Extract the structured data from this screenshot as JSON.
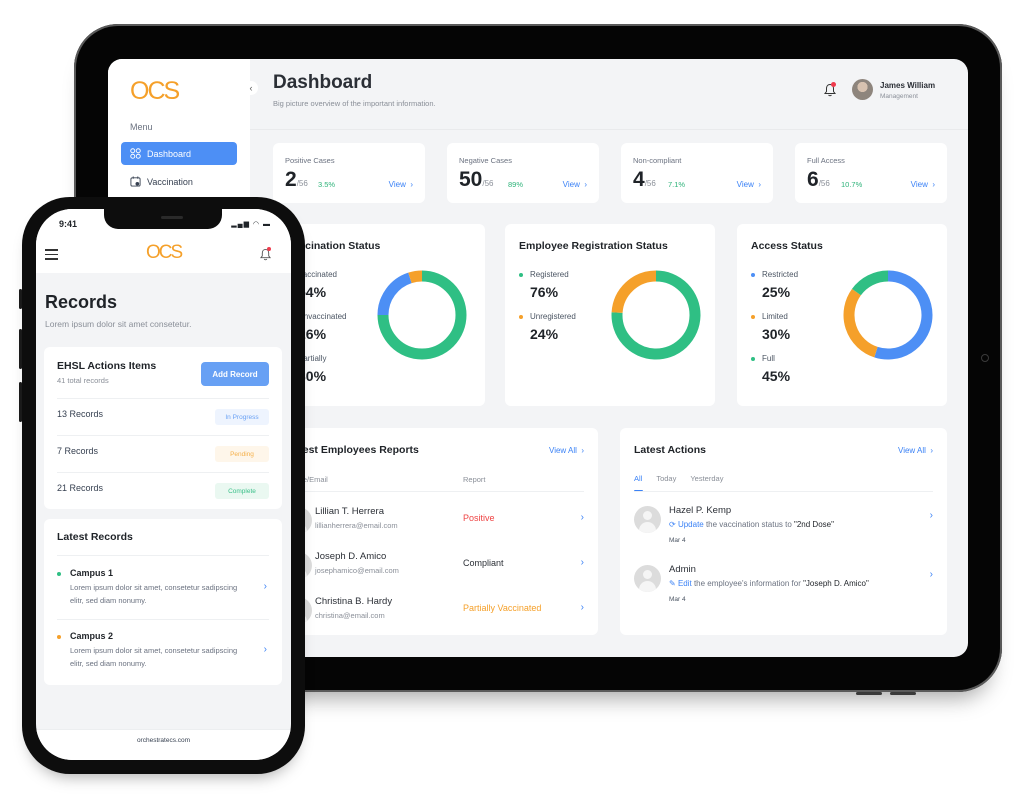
{
  "tablet": {
    "brand": "OCS",
    "sidebar": {
      "menu_label": "Menu",
      "items": [
        {
          "label": "Dashboard",
          "icon": "grid-icon",
          "active": true
        },
        {
          "label": "Vaccination",
          "icon": "calendar-icon",
          "active": false
        }
      ]
    },
    "header": {
      "title": "Dashboard",
      "subtitle": "Big picture overview of the important information.",
      "user_name": "James William",
      "user_role": "Management"
    },
    "stats": [
      {
        "label": "Positive Cases",
        "value": "2",
        "total": "/56",
        "percent": "3.5%",
        "link": "View"
      },
      {
        "label": "Negative Cases",
        "value": "50",
        "total": "/56",
        "percent": "89%",
        "link": "View"
      },
      {
        "label": "Non-compliant",
        "value": "4",
        "total": "/56",
        "percent": "7.1%",
        "link": "View"
      },
      {
        "label": "Full Access",
        "value": "6",
        "total": "/56",
        "percent": "10.7%",
        "link": "View"
      }
    ],
    "vaccination": {
      "title": "Vaccination Status",
      "items": [
        {
          "label": "Vaccinated",
          "value": "54%"
        },
        {
          "label": "Unvaccinated",
          "value": "26%"
        },
        {
          "label": "Partially",
          "value": "30%"
        }
      ]
    },
    "registration": {
      "title": "Employee Registration Status",
      "items": [
        {
          "label": "Registered",
          "value": "76%"
        },
        {
          "label": "Unregistered",
          "value": "24%"
        }
      ]
    },
    "access": {
      "title": "Access Status",
      "items": [
        {
          "label": "Restricted",
          "value": "25%"
        },
        {
          "label": "Limited",
          "value": "30%"
        },
        {
          "label": "Full",
          "value": "45%"
        }
      ]
    },
    "reports": {
      "title": "Latest Employees Reports",
      "view_all": "View All",
      "col_name": "Name/Email",
      "col_report": "Report",
      "rows": [
        {
          "name": "Lillian T. Herrera",
          "email": "lillianherrera@email.com",
          "report": "Positive",
          "color": "#ef4444"
        },
        {
          "name": "Joseph D. Amico",
          "email": "josephamico@email.com",
          "report": "Compliant",
          "color": "#2b2f36"
        },
        {
          "name": "Christina B. Hardy",
          "email": "christina@email.com",
          "report": "Partially Vaccinated",
          "color": "#f5a02a"
        }
      ]
    },
    "actions": {
      "title": "Latest Actions",
      "view_all": "View All",
      "tabs": [
        "All",
        "Today",
        "Yesterday"
      ],
      "active_tab": "All",
      "rows": [
        {
          "name": "Hazel P. Kemp",
          "verb": "Update",
          "text": " the vaccination status to ",
          "target": "\"2nd Dose\"",
          "date": "Mar 4",
          "icon": "refresh-icon"
        },
        {
          "name": "Admin",
          "verb": "Edit",
          "text": " the employee's information for ",
          "target": "\"Joseph D. Amico\"",
          "date": "Mar 4",
          "icon": "pencil-icon"
        }
      ]
    }
  },
  "phone": {
    "time": "9:41",
    "brand": "OCS",
    "title": "Records",
    "subtitle": "Lorem ipsum dolor sit amet consetetur.",
    "ehsl": {
      "title": "EHSL Actions Items",
      "subtitle": "41 total records",
      "add_button": "Add Record",
      "rows": [
        {
          "label": "13 Records",
          "status": "In Progress"
        },
        {
          "label": "7 Records",
          "status": "Pending"
        },
        {
          "label": "21 Records",
          "status": "Complete"
        }
      ]
    },
    "latest": {
      "title": "Latest Records",
      "items": [
        {
          "name": "Campus 1",
          "desc": "Lorem ipsum dolor sit amet, consetetur sadipscing elitr, sed diam nonumy."
        },
        {
          "name": "Campus 2",
          "desc": "Lorem ipsum dolor sit amet, consetetur sadipscing elitr, sed diam nonumy."
        }
      ]
    },
    "footer": "orchestratecs.com"
  },
  "colors": {
    "brand": "#f5a02a",
    "primary": "#4d8ff5",
    "green": "#2fbf84",
    "orange": "#f5a02a",
    "blue": "#4d8ff5",
    "red": "#ef4444"
  },
  "chart_data": [
    {
      "type": "pie",
      "title": "Vaccination Status",
      "categories": [
        "Vaccinated",
        "Unvaccinated",
        "Partially"
      ],
      "values": [
        54,
        26,
        30
      ],
      "ring_values": [
        75,
        20,
        5
      ],
      "colors": [
        "#2fbf84",
        "#4d8ff5",
        "#f5a02a"
      ]
    },
    {
      "type": "pie",
      "title": "Employee Registration Status",
      "categories": [
        "Registered",
        "Unregistered"
      ],
      "values": [
        76,
        24
      ],
      "ring_values": [
        76,
        24
      ],
      "colors": [
        "#2fbf84",
        "#f5a02a"
      ]
    },
    {
      "type": "pie",
      "title": "Access Status",
      "categories": [
        "Restricted",
        "Limited",
        "Full"
      ],
      "values": [
        25,
        30,
        45
      ],
      "ring_values": [
        55,
        30,
        15
      ],
      "colors": [
        "#4d8ff5",
        "#f5a02a",
        "#2fbf84"
      ]
    }
  ]
}
